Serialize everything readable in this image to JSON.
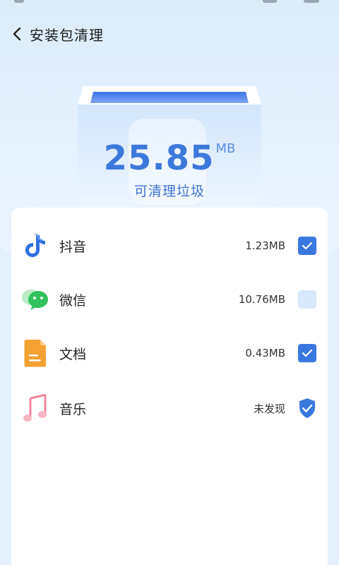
{
  "header": {
    "title": "安装包清理"
  },
  "summary": {
    "size_value": "25.85",
    "size_unit": "MB",
    "caption": "可清理垃圾"
  },
  "items": [
    {
      "name": "抖音",
      "size": "1.23MB",
      "icon": "douyin-icon",
      "checked": true
    },
    {
      "name": "微信",
      "size": "10.76MB",
      "icon": "wechat-icon",
      "checked": false
    },
    {
      "name": "文档",
      "size": "0.43MB",
      "icon": "document-icon",
      "checked": true
    },
    {
      "name": "音乐",
      "size": "未发现",
      "icon": "music-icon",
      "status": "shield-check-icon"
    }
  ],
  "colors": {
    "accent": "#3a78e0",
    "value": "#3d79dc",
    "checkbox_off": "#d9e9fb"
  }
}
